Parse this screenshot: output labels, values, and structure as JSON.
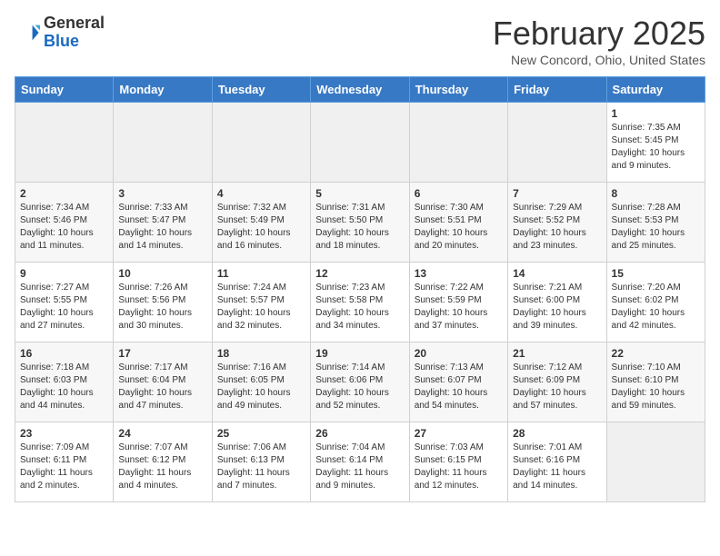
{
  "header": {
    "logo_line1": "General",
    "logo_line2": "Blue",
    "title": "February 2025",
    "subtitle": "New Concord, Ohio, United States"
  },
  "weekdays": [
    "Sunday",
    "Monday",
    "Tuesday",
    "Wednesday",
    "Thursday",
    "Friday",
    "Saturday"
  ],
  "weeks": [
    [
      {
        "day": "",
        "info": ""
      },
      {
        "day": "",
        "info": ""
      },
      {
        "day": "",
        "info": ""
      },
      {
        "day": "",
        "info": ""
      },
      {
        "day": "",
        "info": ""
      },
      {
        "day": "",
        "info": ""
      },
      {
        "day": "1",
        "info": "Sunrise: 7:35 AM\nSunset: 5:45 PM\nDaylight: 10 hours and 9 minutes."
      }
    ],
    [
      {
        "day": "2",
        "info": "Sunrise: 7:34 AM\nSunset: 5:46 PM\nDaylight: 10 hours and 11 minutes."
      },
      {
        "day": "3",
        "info": "Sunrise: 7:33 AM\nSunset: 5:47 PM\nDaylight: 10 hours and 14 minutes."
      },
      {
        "day": "4",
        "info": "Sunrise: 7:32 AM\nSunset: 5:49 PM\nDaylight: 10 hours and 16 minutes."
      },
      {
        "day": "5",
        "info": "Sunrise: 7:31 AM\nSunset: 5:50 PM\nDaylight: 10 hours and 18 minutes."
      },
      {
        "day": "6",
        "info": "Sunrise: 7:30 AM\nSunset: 5:51 PM\nDaylight: 10 hours and 20 minutes."
      },
      {
        "day": "7",
        "info": "Sunrise: 7:29 AM\nSunset: 5:52 PM\nDaylight: 10 hours and 23 minutes."
      },
      {
        "day": "8",
        "info": "Sunrise: 7:28 AM\nSunset: 5:53 PM\nDaylight: 10 hours and 25 minutes."
      }
    ],
    [
      {
        "day": "9",
        "info": "Sunrise: 7:27 AM\nSunset: 5:55 PM\nDaylight: 10 hours and 27 minutes."
      },
      {
        "day": "10",
        "info": "Sunrise: 7:26 AM\nSunset: 5:56 PM\nDaylight: 10 hours and 30 minutes."
      },
      {
        "day": "11",
        "info": "Sunrise: 7:24 AM\nSunset: 5:57 PM\nDaylight: 10 hours and 32 minutes."
      },
      {
        "day": "12",
        "info": "Sunrise: 7:23 AM\nSunset: 5:58 PM\nDaylight: 10 hours and 34 minutes."
      },
      {
        "day": "13",
        "info": "Sunrise: 7:22 AM\nSunset: 5:59 PM\nDaylight: 10 hours and 37 minutes."
      },
      {
        "day": "14",
        "info": "Sunrise: 7:21 AM\nSunset: 6:00 PM\nDaylight: 10 hours and 39 minutes."
      },
      {
        "day": "15",
        "info": "Sunrise: 7:20 AM\nSunset: 6:02 PM\nDaylight: 10 hours and 42 minutes."
      }
    ],
    [
      {
        "day": "16",
        "info": "Sunrise: 7:18 AM\nSunset: 6:03 PM\nDaylight: 10 hours and 44 minutes."
      },
      {
        "day": "17",
        "info": "Sunrise: 7:17 AM\nSunset: 6:04 PM\nDaylight: 10 hours and 47 minutes."
      },
      {
        "day": "18",
        "info": "Sunrise: 7:16 AM\nSunset: 6:05 PM\nDaylight: 10 hours and 49 minutes."
      },
      {
        "day": "19",
        "info": "Sunrise: 7:14 AM\nSunset: 6:06 PM\nDaylight: 10 hours and 52 minutes."
      },
      {
        "day": "20",
        "info": "Sunrise: 7:13 AM\nSunset: 6:07 PM\nDaylight: 10 hours and 54 minutes."
      },
      {
        "day": "21",
        "info": "Sunrise: 7:12 AM\nSunset: 6:09 PM\nDaylight: 10 hours and 57 minutes."
      },
      {
        "day": "22",
        "info": "Sunrise: 7:10 AM\nSunset: 6:10 PM\nDaylight: 10 hours and 59 minutes."
      }
    ],
    [
      {
        "day": "23",
        "info": "Sunrise: 7:09 AM\nSunset: 6:11 PM\nDaylight: 11 hours and 2 minutes."
      },
      {
        "day": "24",
        "info": "Sunrise: 7:07 AM\nSunset: 6:12 PM\nDaylight: 11 hours and 4 minutes."
      },
      {
        "day": "25",
        "info": "Sunrise: 7:06 AM\nSunset: 6:13 PM\nDaylight: 11 hours and 7 minutes."
      },
      {
        "day": "26",
        "info": "Sunrise: 7:04 AM\nSunset: 6:14 PM\nDaylight: 11 hours and 9 minutes."
      },
      {
        "day": "27",
        "info": "Sunrise: 7:03 AM\nSunset: 6:15 PM\nDaylight: 11 hours and 12 minutes."
      },
      {
        "day": "28",
        "info": "Sunrise: 7:01 AM\nSunset: 6:16 PM\nDaylight: 11 hours and 14 minutes."
      },
      {
        "day": "",
        "info": ""
      }
    ]
  ]
}
